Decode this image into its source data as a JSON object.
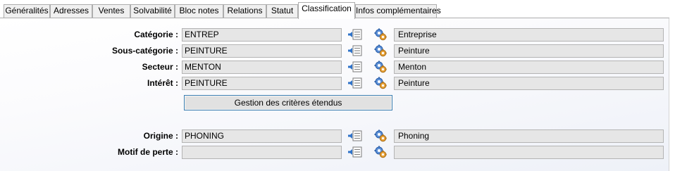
{
  "tabs": [
    {
      "label": "Généralités",
      "active": false
    },
    {
      "label": "Adresses",
      "active": false
    },
    {
      "label": "Ventes",
      "active": false
    },
    {
      "label": "Solvabilité",
      "active": false
    },
    {
      "label": "Bloc notes",
      "active": false
    },
    {
      "label": "Relations",
      "active": false
    },
    {
      "label": "Statut",
      "active": false
    },
    {
      "label": "Classification",
      "active": true
    },
    {
      "label": "Infos complémentaires",
      "active": false
    }
  ],
  "form": {
    "categorie": {
      "label": "Catégorie :",
      "code": "ENTREP",
      "description": "Entreprise"
    },
    "sous_categorie": {
      "label": "Sous-catégorie :",
      "code": "PEINTURE",
      "description": "Peinture"
    },
    "secteur": {
      "label": "Secteur :",
      "code": "MENTON",
      "description": "Menton"
    },
    "interet": {
      "label": "Intérêt :",
      "code": "PEINTURE",
      "description": "Peinture"
    },
    "criteres_button": "Gestion des critères étendus",
    "origine": {
      "label": "Origine :",
      "code": "PHONING",
      "description": "Phoning"
    },
    "motif_perte": {
      "label": "Motif de perte :",
      "code": "",
      "description": ""
    }
  },
  "icons": {
    "list": "list-arrow-icon",
    "gear": "gear-icon"
  },
  "colors": {
    "accent": "#3c7fb1",
    "field_bg": "#e6e6e6"
  }
}
